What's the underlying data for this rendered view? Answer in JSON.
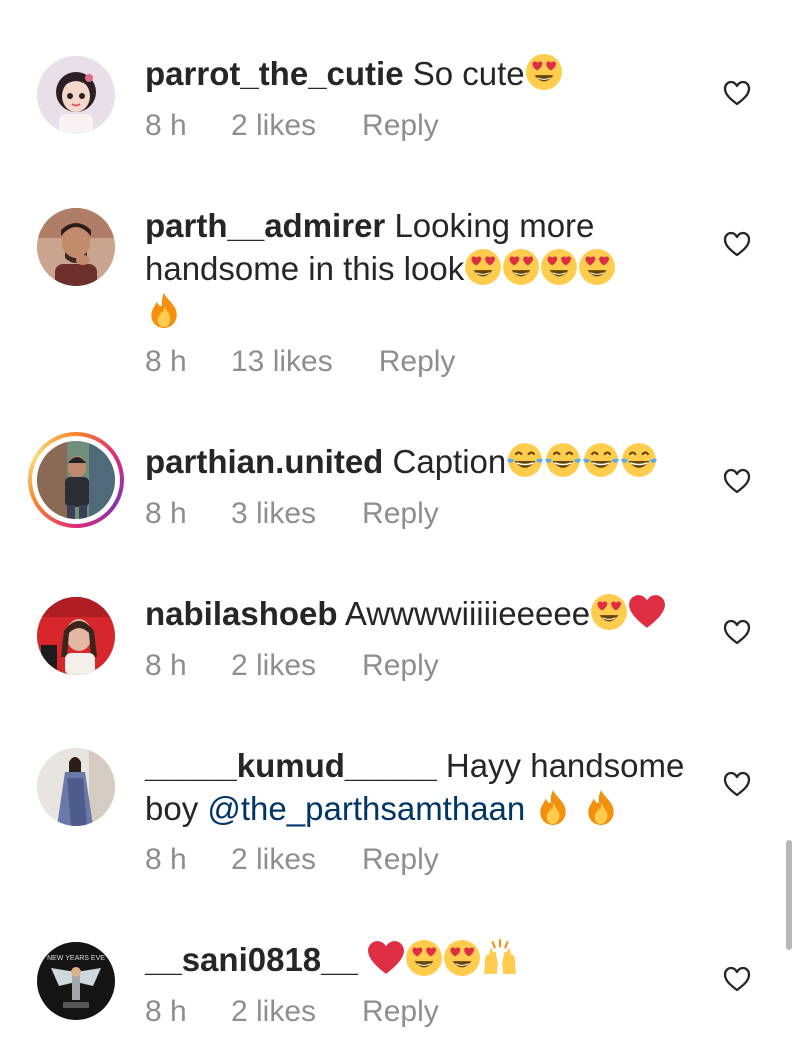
{
  "comments": [
    {
      "username": "parrot_the_cutie",
      "text": "So cute",
      "time": "8 h",
      "likes": "2 likes",
      "reply": "Reply"
    },
    {
      "username": "parth__admirer",
      "text": "Looking more handsome in this look",
      "time": "8 h",
      "likes": "13 likes",
      "reply": "Reply"
    },
    {
      "username": "parthian.united",
      "text": "Caption",
      "time": "8 h",
      "likes": "3 likes",
      "reply": "Reply"
    },
    {
      "username": "nabilashoeb",
      "text": "Awwwwiiiiieeeee",
      "time": "8 h",
      "likes": "2 likes",
      "reply": "Reply"
    },
    {
      "username": "_____kumud_____",
      "text": "Hayy handsome boy",
      "mention": "@the_parthsamthaan",
      "time": "8 h",
      "likes": "2 likes",
      "reply": "Reply"
    },
    {
      "username": "__sani0818__",
      "avatar_caption": "NEW YEARS EVE",
      "time": "8 h",
      "likes": "2 likes",
      "reply": "Reply"
    }
  ],
  "icons": {
    "like": "heart-outline-icon",
    "heart_eyes": "heart-eyes-emoji-icon",
    "fire": "fire-emoji-icon",
    "tears_of_joy": "tears-of-joy-emoji-icon",
    "red_heart": "red-heart-emoji-icon",
    "raised_hands": "raised-hands-emoji-icon"
  },
  "colors": {
    "username": "#262626",
    "meta": "#8e8e8e",
    "mention": "#003569",
    "emoji_face": "#FFCC4D",
    "emoji_heart": "#DD2E44"
  }
}
